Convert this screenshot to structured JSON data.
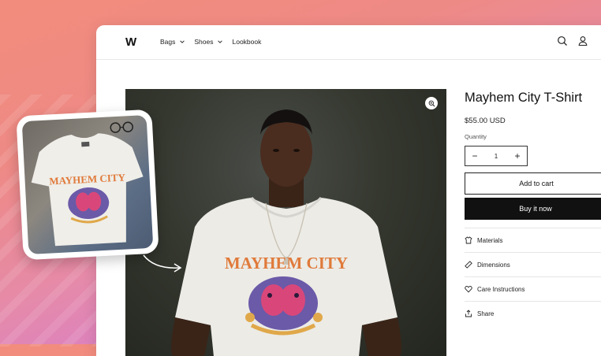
{
  "header": {
    "logo": "W",
    "nav": [
      {
        "label": "Bags",
        "has_dropdown": true
      },
      {
        "label": "Shoes",
        "has_dropdown": true
      },
      {
        "label": "Lookbook",
        "has_dropdown": false
      }
    ],
    "icons": [
      "search-icon",
      "account-icon"
    ]
  },
  "product": {
    "title": "Mayhem City T-Shirt",
    "price": "$55.00 USD",
    "quantity_label": "Quantity",
    "quantity_value": "1",
    "add_to_cart": "Add to cart",
    "buy_now": "Buy it now",
    "accordion": [
      {
        "label": "Materials",
        "icon": "materials-icon"
      },
      {
        "label": "Dimensions",
        "icon": "ruler-icon"
      },
      {
        "label": "Care Instructions",
        "icon": "heart-icon"
      },
      {
        "label": "Share",
        "icon": "share-icon"
      }
    ]
  },
  "images": {
    "main": "model-wearing-tshirt-photo",
    "inset": "flat-lay-tshirt-photo",
    "shirt_print": "MAYHEM CITY"
  },
  "colors": {
    "accent": "#111111",
    "background_gradient_start": "#f28c7c",
    "background_gradient_end": "#cf78e0"
  }
}
